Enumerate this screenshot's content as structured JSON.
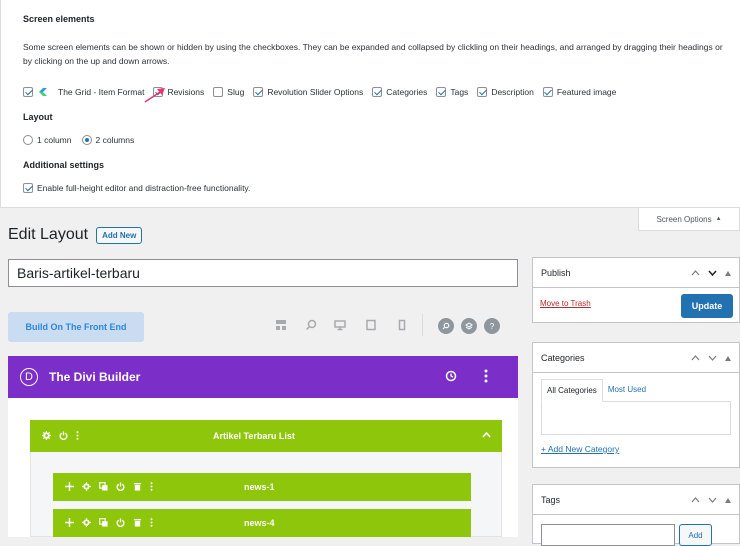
{
  "screen_options": {
    "heading": "Screen elements",
    "description": "Some screen elements can be shown or hidden by using the checkboxes. They can be expanded and collapsed by clickling on their headings, and arranged by dragging their headings or by clicking on the up and down arrows.",
    "elements": [
      {
        "label": "The Grid - Item Format",
        "checked": true
      },
      {
        "label": "Revisions",
        "checked": true
      },
      {
        "label": "Slug",
        "checked": false
      },
      {
        "label": "Revolution Slider Options",
        "checked": true
      },
      {
        "label": "Categories",
        "checked": true
      },
      {
        "label": "Tags",
        "checked": true
      },
      {
        "label": "Description",
        "checked": true
      },
      {
        "label": "Featured image",
        "checked": true
      }
    ],
    "layout_heading": "Layout",
    "layout_options": [
      {
        "label": "1 column",
        "checked": false
      },
      {
        "label": "2 columns",
        "checked": true
      }
    ],
    "additional_heading": "Additional settings",
    "fullheight_label": "Enable full-height editor and distraction-free functionality.",
    "fullheight_checked": true,
    "tab_label": "Screen Options",
    "tab_arrow": "▲"
  },
  "editor": {
    "page_title": "Edit Layout",
    "add_new": "Add New",
    "title_value": "Baris-artikel-terbaru",
    "front_end_button": "Build On The Front End"
  },
  "divi": {
    "title": "The Divi Builder",
    "logo_letter": "D",
    "section_label": "Artikel Terbaru List",
    "rows": [
      {
        "label": "news-1"
      },
      {
        "label": "news-4"
      }
    ]
  },
  "publish": {
    "title": "Publish",
    "trash": "Move to Trash",
    "update": "Update"
  },
  "categories": {
    "title": "Categories",
    "tab_all": "All Categories",
    "tab_used": "Most Used",
    "add_new": "+ Add New Category"
  },
  "tags": {
    "title": "Tags",
    "add": "Add"
  },
  "colors": {
    "divi_purple": "#7b2fc8",
    "divi_green": "#8dc60b",
    "wp_blue": "#2271b1",
    "arrow_pink": "#e8336d"
  }
}
